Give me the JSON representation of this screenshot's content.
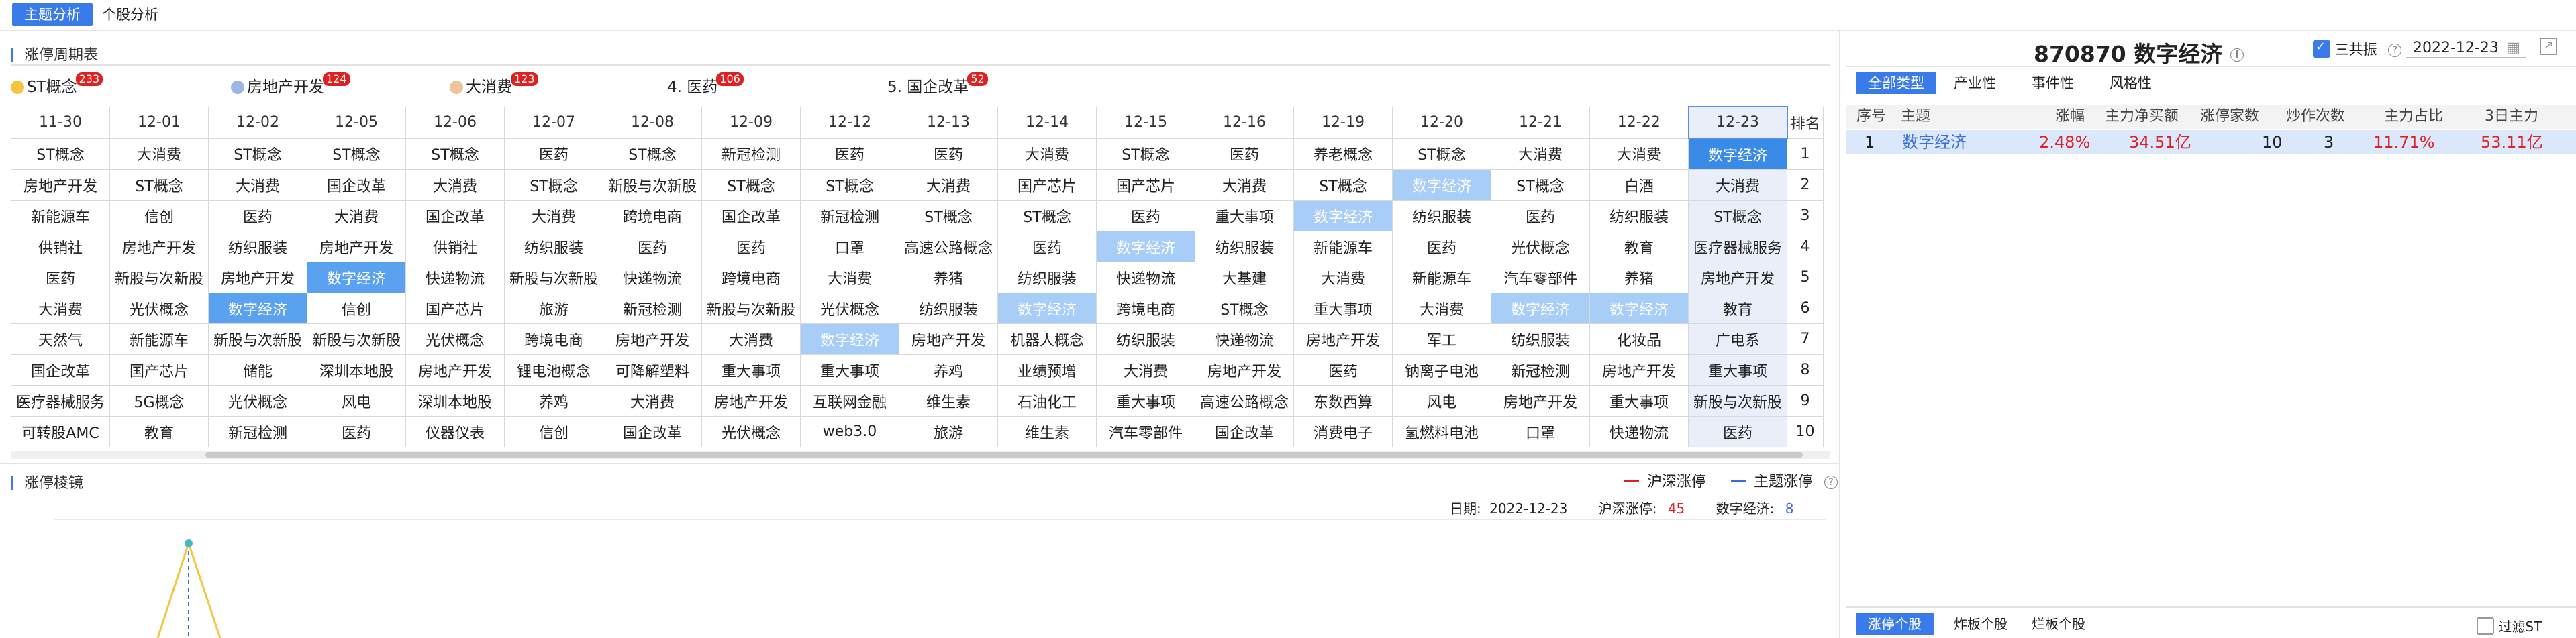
{
  "nav": {
    "tabs": [
      "主题分析",
      "个股分析"
    ],
    "active": 0
  },
  "cycle": {
    "title": "涨停周期表",
    "top_themes": [
      {
        "label": "ST概念",
        "badge": "233",
        "dot_color": "#f5c542"
      },
      {
        "label": "房地产开发",
        "badge": "124",
        "dot_color": "#9ab7e6"
      },
      {
        "label": "大消费",
        "badge": "123",
        "dot_color": "#f0c39a"
      },
      {
        "label": "4. 医药",
        "badge": "106",
        "dot_color": ""
      },
      {
        "label": "5. 国企改革",
        "badge": "52",
        "dot_color": ""
      }
    ],
    "rank_header": "排名",
    "dates": [
      "11-30",
      "12-01",
      "12-02",
      "12-05",
      "12-06",
      "12-07",
      "12-08",
      "12-09",
      "12-12",
      "12-13",
      "12-14",
      "12-15",
      "12-16",
      "12-19",
      "12-20",
      "12-21",
      "12-22",
      "12-23"
    ],
    "rows": [
      [
        "ST概念",
        "大消费",
        "ST概念",
        "ST概念",
        "ST概念",
        "医药",
        "ST概念",
        "新冠检测",
        "医药",
        "医药",
        "大消费",
        "ST概念",
        "医药",
        "养老概念",
        "ST概念",
        "大消费",
        "大消费",
        "数字经济"
      ],
      [
        "房地产开发",
        "ST概念",
        "大消费",
        "国企改革",
        "大消费",
        "ST概念",
        "新股与次新股",
        "ST概念",
        "ST概念",
        "大消费",
        "国产芯片",
        "国产芯片",
        "大消费",
        "ST概念",
        "数字经济",
        "ST概念",
        "白酒",
        "大消费"
      ],
      [
        "新能源车",
        "信创",
        "医药",
        "大消费",
        "国企改革",
        "大消费",
        "跨境电商",
        "国企改革",
        "新冠检测",
        "ST概念",
        "ST概念",
        "医药",
        "重大事项",
        "数字经济",
        "纺织服装",
        "医药",
        "纺织服装",
        "ST概念"
      ],
      [
        "供销社",
        "房地产开发",
        "纺织服装",
        "房地产开发",
        "供销社",
        "纺织服装",
        "医药",
        "医药",
        "口罩",
        "高速公路概念",
        "医药",
        "数字经济",
        "纺织服装",
        "新能源车",
        "医药",
        "光伏概念",
        "教育",
        "医疗器械服务"
      ],
      [
        "医药",
        "新股与次新股",
        "房地产开发",
        "数字经济",
        "快递物流",
        "新股与次新股",
        "快递物流",
        "跨境电商",
        "大消费",
        "养猪",
        "纺织服装",
        "快递物流",
        "大基建",
        "大消费",
        "新能源车",
        "汽车零部件",
        "养猪",
        "房地产开发"
      ],
      [
        "大消费",
        "光伏概念",
        "数字经济",
        "信创",
        "国产芯片",
        "旅游",
        "新冠检测",
        "新股与次新股",
        "光伏概念",
        "纺织服装",
        "数字经济",
        "跨境电商",
        "ST概念",
        "重大事项",
        "大消费",
        "数字经济",
        "数字经济",
        "教育"
      ],
      [
        "天然气",
        "新能源车",
        "新股与次新股",
        "新股与次新股",
        "光伏概念",
        "跨境电商",
        "房地产开发",
        "大消费",
        "数字经济",
        "房地产开发",
        "机器人概念",
        "纺织服装",
        "快递物流",
        "房地产开发",
        "军工",
        "纺织服装",
        "化妆品",
        "广电系"
      ],
      [
        "国企改革",
        "国产芯片",
        "储能",
        "深圳本地股",
        "房地产开发",
        "锂电池概念",
        "可降解塑料",
        "重大事项",
        "重大事项",
        "养鸡",
        "业绩预增",
        "大消费",
        "房地产开发",
        "医药",
        "钠离子电池",
        "新冠检测",
        "房地产开发",
        "重大事项"
      ],
      [
        "医疗器械服务",
        "5G概念",
        "光伏概念",
        "风电",
        "深圳本地股",
        "养鸡",
        "大消费",
        "房地产开发",
        "互联网金融",
        "维生素",
        "石油化工",
        "重大事项",
        "高速公路概念",
        "东数西算",
        "风电",
        "房地产开发",
        "重大事项",
        "新股与次新股"
      ],
      [
        "可转股AMC",
        "教育",
        "新冠检测",
        "医药",
        "仪器仪表",
        "信创",
        "国企改革",
        "光伏概念",
        "web3.0",
        "旅游",
        "维生素",
        "汽车零部件",
        "国企改革",
        "消费电子",
        "氢燃料电池",
        "口罩",
        "快递物流",
        "医药"
      ]
    ],
    "ranks": [
      "1",
      "2",
      "3",
      "4",
      "5",
      "6",
      "7",
      "8",
      "9",
      "10"
    ],
    "highlight_theme": "数字经济"
  },
  "mirror": {
    "title": "涨停棱镜",
    "legend": [
      "沪深涨停",
      "主题涨停"
    ],
    "legend_colors": [
      "#e02020",
      "#3a6fd8"
    ],
    "info": {
      "date_label": "日期:",
      "date": "2022-12-23",
      "hs_label": "沪深涨停:",
      "hs_value": "45",
      "theme_label": "数字经济:",
      "theme_value": "8"
    }
  },
  "right": {
    "title": "870870 数字经济",
    "three_board_label": "三共振",
    "date_value": "2022-12-23",
    "type_tabs": [
      "全部类型",
      "产业性",
      "事件性",
      "风格性"
    ],
    "table": {
      "headers": [
        "序号",
        "主题",
        "涨幅",
        "主力净买额",
        "涨停家数",
        "炒作次数",
        "主力占比",
        "3日主力"
      ],
      "rows": [
        [
          "1",
          "数字经济",
          "2.48%",
          "34.51亿",
          "10",
          "3",
          "11.71%",
          "53.11亿"
        ]
      ]
    },
    "bottom_tabs": [
      "涨停个股",
      "炸板个股",
      "烂板个股"
    ],
    "filter_label": "过滤ST"
  },
  "chart_data": {
    "type": "line",
    "title": "",
    "series": [
      {
        "name": "沪深涨停",
        "values": []
      },
      {
        "name": "主题涨停",
        "values": []
      }
    ]
  }
}
